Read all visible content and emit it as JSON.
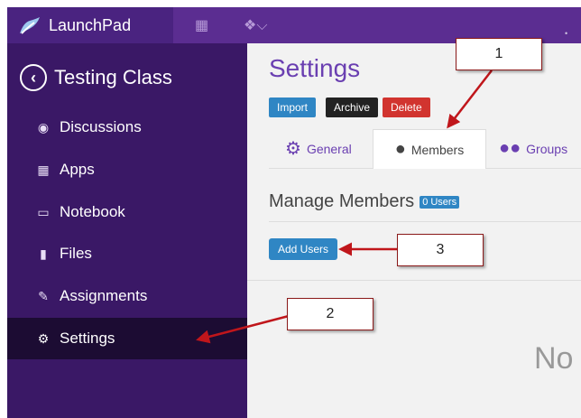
{
  "topbar": {
    "brand": "LaunchPad",
    "icons": [
      "calendar-icon",
      "leaf-dropdown-icon"
    ]
  },
  "sidebar": {
    "course_title": "Testing Class",
    "items": [
      {
        "label": "Discussions",
        "icon": "chat-icon"
      },
      {
        "label": "Apps",
        "icon": "grid-icon"
      },
      {
        "label": "Notebook",
        "icon": "notebook-icon"
      },
      {
        "label": "Files",
        "icon": "file-icon"
      },
      {
        "label": "Assignments",
        "icon": "edit-icon"
      },
      {
        "label": "Settings",
        "icon": "gear-icon",
        "active": true
      }
    ]
  },
  "main": {
    "title": "Settings",
    "actions": {
      "import": "Import",
      "archive": "Archive",
      "delete": "Delete"
    },
    "tabs": [
      {
        "label": "General",
        "icon": "gear-icon"
      },
      {
        "label": "Members",
        "icon": "user-icon",
        "active": true
      },
      {
        "label": "Groups",
        "icon": "users-icon"
      }
    ],
    "manage_title": "Manage Members",
    "users_badge": "0 Users",
    "add_users": "Add Users",
    "empty_text": "No"
  },
  "callouts": {
    "one": "1",
    "two": "2",
    "three": "3"
  },
  "colors": {
    "topbar": "#5b2d91",
    "sidebar": "#3a1866",
    "sidebar_active": "#1c0c33",
    "title": "#6a3fb1",
    "primary": "#2f86c4",
    "danger": "#d1342f",
    "callout_arrow": "#c0161b"
  }
}
